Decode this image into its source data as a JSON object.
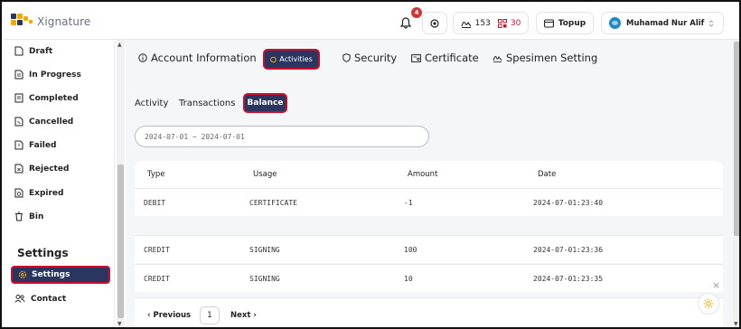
{
  "app": {
    "logo_text": "Xignature"
  },
  "header": {
    "notifications_count": "4",
    "stamp_count": "153",
    "qr_count": "30",
    "topup_label": "Topup",
    "user_name": "Muhamad Nur Alif",
    "accent_red": "#c8102e",
    "accent_navy": "#2a3560"
  },
  "sidebar": {
    "items": [
      {
        "label": "Draft",
        "icon": "document-icon"
      },
      {
        "label": "In Progress",
        "icon": "document-icon"
      },
      {
        "label": "Completed",
        "icon": "document-check-icon"
      },
      {
        "label": "Cancelled",
        "icon": "document-icon"
      },
      {
        "label": "Failed",
        "icon": "document-icon"
      },
      {
        "label": "Rejected",
        "icon": "document-icon"
      },
      {
        "label": "Expired",
        "icon": "document-icon"
      },
      {
        "label": "Bin",
        "icon": "trash-icon"
      }
    ],
    "settings_heading": "Settings",
    "settings_item": "Settings",
    "contact_item": "Contact"
  },
  "tabs": {
    "account": "Account Information",
    "activities": "Activities",
    "security": "Security",
    "certificate": "Certificate",
    "specimen": "Spesimen Setting"
  },
  "subtabs": {
    "activity": "Activity",
    "transactions": "Transactions",
    "balance": "Balance"
  },
  "filter": {
    "date_range": "2024-07-01 ~ 2024-07-01"
  },
  "table": {
    "columns": [
      "Type",
      "Usage",
      "Amount",
      "Date"
    ],
    "rows": [
      {
        "type": "DEBIT",
        "usage": "CERTIFICATE",
        "amount": "-1",
        "date": "2024-07-01:23:40"
      },
      {
        "type": "",
        "usage": "",
        "amount": "",
        "date": ""
      },
      {
        "type": "CREDIT",
        "usage": "SIGNING",
        "amount": "100",
        "date": "2024-07-01:23:36"
      },
      {
        "type": "CREDIT",
        "usage": "SIGNING",
        "amount": "10",
        "date": "2024-07-01:23:35"
      }
    ]
  },
  "pagination": {
    "previous": "Previous",
    "page": "1",
    "next": "Next"
  }
}
